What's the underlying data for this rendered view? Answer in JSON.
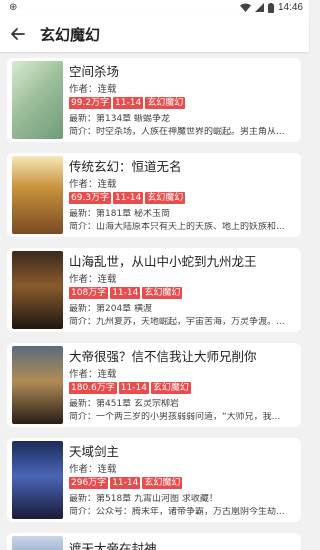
{
  "status": {
    "left": "⊕",
    "time": "14:46"
  },
  "appbar": {
    "title": "玄幻魔幻"
  },
  "books": [
    {
      "title": "空间杀场",
      "author": "作者：连载",
      "tags": [
        "99.2万字",
        "11-14",
        "玄幻魔幻"
      ],
      "latest": "最新：第134章 蜥蜴争龙",
      "summary": "简介：时空杀场，人族在神魔世界的崛起。男主角从..."
    },
    {
      "title": "传统玄幻：恒道无名",
      "author": "作者：连载",
      "tags": [
        "69.3万字",
        "11-14",
        "玄幻魔幻"
      ],
      "latest": "最新：第181章 秘术玉简",
      "summary": "简介：山海大陆原本只有天上的天族、地上的妖族和..."
    },
    {
      "title": "山海乱世，从山中小蛇到九州龙王",
      "author": "作者：连载",
      "tags": [
        "108万字",
        "11-14",
        "玄幻魔幻"
      ],
      "latest": "最新：第204章 横渡",
      "summary": "简介：九州复苏，天地崛起，宇宙苦海，万灵争渡。..."
    },
    {
      "title": "大帝很强？信不信我让大师兄削你",
      "author": "作者：连载",
      "tags": [
        "180.6万字",
        "11-14",
        "玄幻魔幻"
      ],
      "latest": "最新：第451章 玄灵宗柳岩",
      "summary": "简介：一个两三岁的小男孩弱弱问道，“大师兄，我..."
    },
    {
      "title": "天域剑主",
      "author": "作者：连载",
      "tags": [
        "296万字",
        "11-14",
        "玄幻魔幻"
      ],
      "latest": "最新：第518章 九霄山河图 求收藏！",
      "summary": "简介：公众号：腾末年，诸帝争霸，万古凰阴今生劫..."
    }
  ],
  "peek": {
    "title": "遮天大帝在封神"
  },
  "colors": {
    "tag": "#e94c4c",
    "card": "#ffffff",
    "bg": "#f1f1f1"
  }
}
